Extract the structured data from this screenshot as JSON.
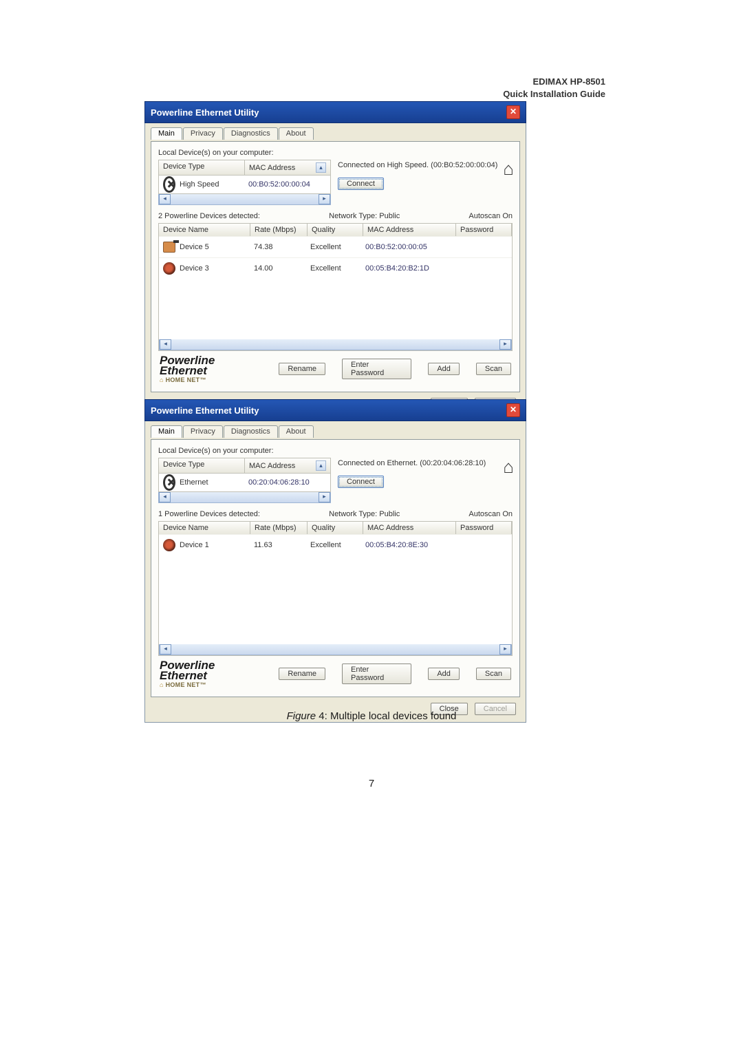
{
  "header": {
    "line1": "EDIMAX  HP-8501",
    "line2": "Quick Installation Guide"
  },
  "dialog_title": "Powerline Ethernet Utility",
  "tabs": [
    "Main",
    "Privacy",
    "Diagnostics",
    "About"
  ],
  "labels": {
    "local_devices": "Local Device(s) on your computer:",
    "device_type_hdr": "Device Type",
    "mac_hdr": "MAC Address",
    "connect_btn": "Connect",
    "network_type": "Network Type: Public",
    "autoscan": "Autoscan On",
    "dev_name_hdr": "Device Name",
    "rate_hdr": "Rate (Mbps)",
    "quality_hdr": "Quality",
    "mac_hdr2": "MAC Address",
    "password_hdr": "Password",
    "rename_btn": "Rename",
    "enterpw_btn": "Enter Password",
    "add_btn": "Add",
    "scan_btn": "Scan",
    "close_btn": "Close",
    "cancel_btn": "Cancel",
    "brand": "Powerline Ethernet",
    "brand_sub": "HOME NET"
  },
  "window1": {
    "local": {
      "type": "High Speed",
      "mac": "00:B0:52:00:00:04"
    },
    "conn_status": "Connected on  High Speed. (00:B0:52:00:00:04)",
    "devices_detected": "2 Powerline Devices detected:",
    "rows": [
      {
        "name": "Device 5",
        "rate": "74.38",
        "quality": "Excellent",
        "mac": "00:B0:52:00:00:05",
        "password": ""
      },
      {
        "name": "Device 3",
        "rate": "14.00",
        "quality": "Excellent",
        "mac": "00:05:B4:20:B2:1D",
        "password": ""
      }
    ]
  },
  "window2": {
    "local": {
      "type": "Ethernet",
      "mac": "00:20:04:06:28:10"
    },
    "conn_status": "Connected on Ethernet. (00:20:04:06:28:10)",
    "devices_detected": "1 Powerline Devices detected:",
    "rows": [
      {
        "name": "Device 1",
        "rate": "11.63",
        "quality": "Excellent",
        "mac": "00:05:B4:20:8E:30",
        "password": ""
      }
    ]
  },
  "caption": {
    "prefix": "Figure ",
    "num": "4",
    "text": ": Multiple local devices found"
  },
  "page_number": "7"
}
